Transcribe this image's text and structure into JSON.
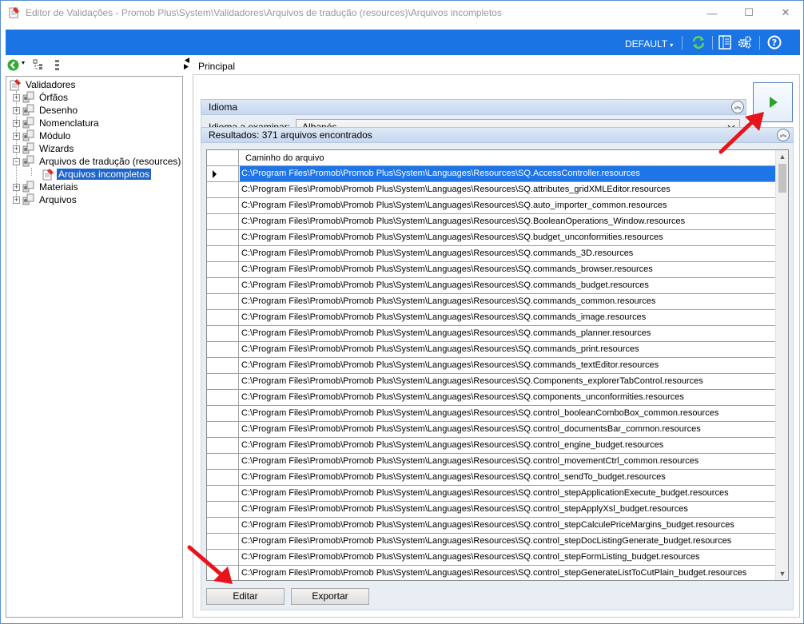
{
  "window": {
    "title": "Editor de Validações - Promob Plus\\System\\Validadores\\Arquivos de tradução (resources)\\Arquivos incompletos",
    "minimize": "—",
    "maximize": "☐",
    "close": "✕"
  },
  "toolbar": {
    "profile_label": "DEFAULT",
    "profile_caret": "▾"
  },
  "tree": {
    "root": "Validadores",
    "items": [
      {
        "label": "Órfãos"
      },
      {
        "label": "Desenho"
      },
      {
        "label": "Nomenclatura"
      },
      {
        "label": "Módulo"
      },
      {
        "label": "Wizards"
      },
      {
        "label": "Arquivos de tradução (resources)"
      },
      {
        "label": "Arquivos incompletos"
      },
      {
        "label": "Materiais"
      },
      {
        "label": "Arquivos"
      }
    ],
    "expander_plus": "+",
    "expander_minus": "−"
  },
  "main": {
    "tab_label": "Principal",
    "idioma": {
      "header": "Idioma",
      "field_label": "Idioma a examinar:",
      "selected": "Albanés"
    },
    "results": {
      "header": "Resultados: 371 arquivos encontrados",
      "column": "Caminho do arquivo",
      "rows": [
        "C:\\Program Files\\Promob\\Promob Plus\\System\\Languages\\Resources\\SQ.AccessController.resources",
        "C:\\Program Files\\Promob\\Promob Plus\\System\\Languages\\Resources\\SQ.attributes_gridXMLEditor.resources",
        "C:\\Program Files\\Promob\\Promob Plus\\System\\Languages\\Resources\\SQ.auto_importer_common.resources",
        "C:\\Program Files\\Promob\\Promob Plus\\System\\Languages\\Resources\\SQ.BooleanOperations_Window.resources",
        "C:\\Program Files\\Promob\\Promob Plus\\System\\Languages\\Resources\\SQ.budget_unconformities.resources",
        "C:\\Program Files\\Promob\\Promob Plus\\System\\Languages\\Resources\\SQ.commands_3D.resources",
        "C:\\Program Files\\Promob\\Promob Plus\\System\\Languages\\Resources\\SQ.commands_browser.resources",
        "C:\\Program Files\\Promob\\Promob Plus\\System\\Languages\\Resources\\SQ.commands_budget.resources",
        "C:\\Program Files\\Promob\\Promob Plus\\System\\Languages\\Resources\\SQ.commands_common.resources",
        "C:\\Program Files\\Promob\\Promob Plus\\System\\Languages\\Resources\\SQ.commands_image.resources",
        "C:\\Program Files\\Promob\\Promob Plus\\System\\Languages\\Resources\\SQ.commands_planner.resources",
        "C:\\Program Files\\Promob\\Promob Plus\\System\\Languages\\Resources\\SQ.commands_print.resources",
        "C:\\Program Files\\Promob\\Promob Plus\\System\\Languages\\Resources\\SQ.commands_textEditor.resources",
        "C:\\Program Files\\Promob\\Promob Plus\\System\\Languages\\Resources\\SQ.Components_explorerTabControl.resources",
        "C:\\Program Files\\Promob\\Promob Plus\\System\\Languages\\Resources\\SQ.components_unconformities.resources",
        "C:\\Program Files\\Promob\\Promob Plus\\System\\Languages\\Resources\\SQ.control_booleanComboBox_common.resources",
        "C:\\Program Files\\Promob\\Promob Plus\\System\\Languages\\Resources\\SQ.control_documentsBar_common.resources",
        "C:\\Program Files\\Promob\\Promob Plus\\System\\Languages\\Resources\\SQ.control_engine_budget.resources",
        "C:\\Program Files\\Promob\\Promob Plus\\System\\Languages\\Resources\\SQ.control_movementCtrl_common.resources",
        "C:\\Program Files\\Promob\\Promob Plus\\System\\Languages\\Resources\\SQ.control_sendTo_budget.resources",
        "C:\\Program Files\\Promob\\Promob Plus\\System\\Languages\\Resources\\SQ.control_stepApplicationExecute_budget.resources",
        "C:\\Program Files\\Promob\\Promob Plus\\System\\Languages\\Resources\\SQ.control_stepApplyXsl_budget.resources",
        "C:\\Program Files\\Promob\\Promob Plus\\System\\Languages\\Resources\\SQ.control_stepCalculePriceMargins_budget.resources",
        "C:\\Program Files\\Promob\\Promob Plus\\System\\Languages\\Resources\\SQ.control_stepDocListingGenerate_budget.resources",
        "C:\\Program Files\\Promob\\Promob Plus\\System\\Languages\\Resources\\SQ.control_stepFormListing_budget.resources",
        "C:\\Program Files\\Promob\\Promob Plus\\System\\Languages\\Resources\\SQ.control_stepGenerateListToCutPlain_budget.resources"
      ]
    },
    "buttons": {
      "edit": "Editar",
      "export": "Exportar"
    }
  },
  "colors": {
    "accent": "#1b74e4",
    "selection": "#1f75e8",
    "annotation": "#e8141b"
  }
}
